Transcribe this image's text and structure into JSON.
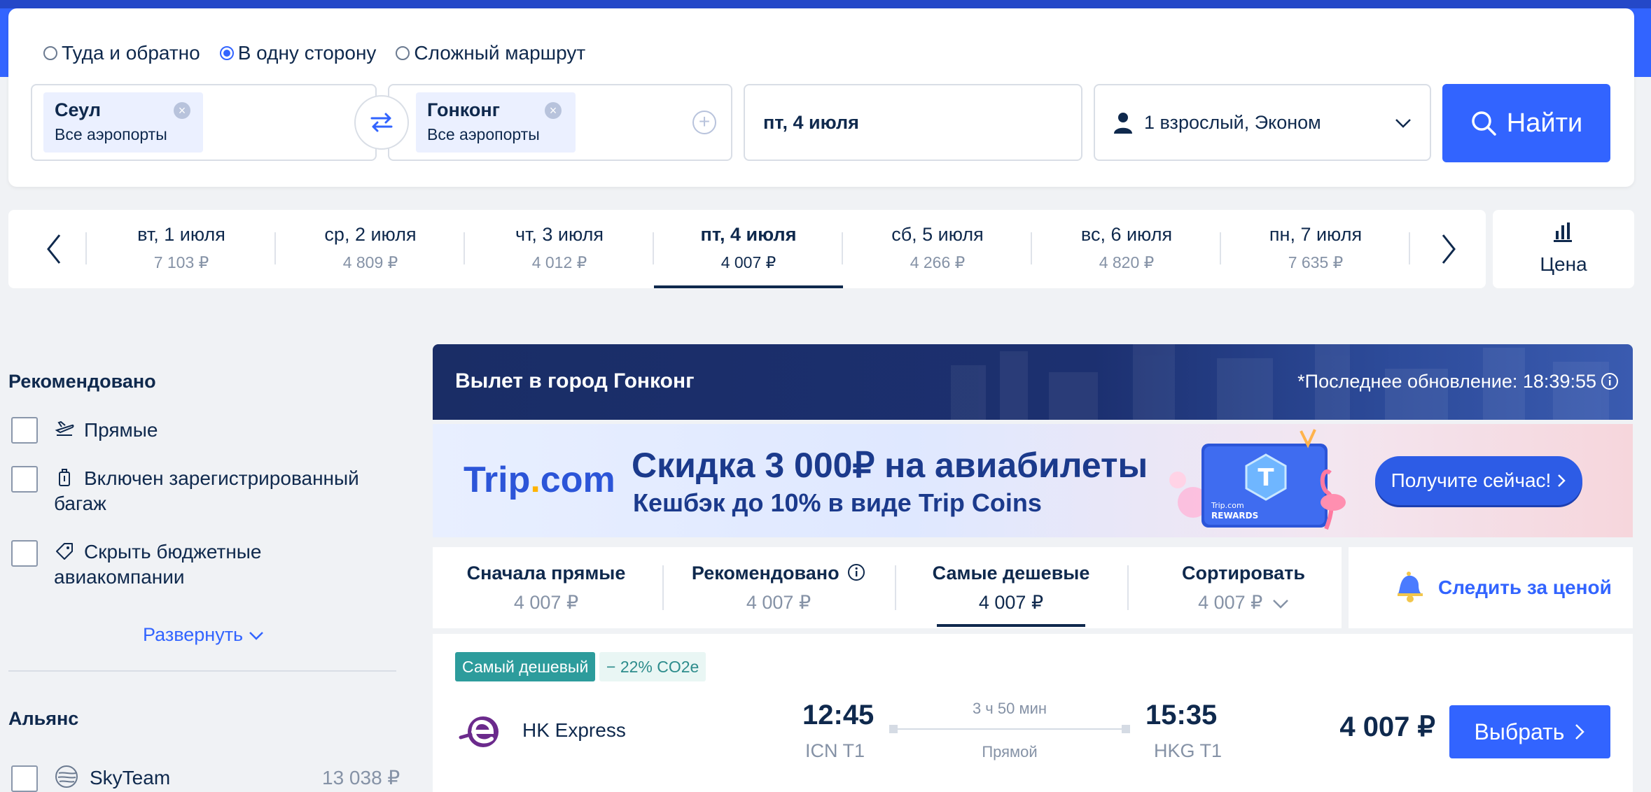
{
  "trip_types": [
    {
      "label": "Туда и обратно",
      "selected": false
    },
    {
      "label": "В одну сторону",
      "selected": true
    },
    {
      "label": "Сложный маршрут",
      "selected": false
    }
  ],
  "from": {
    "city": "Сеул",
    "airports": "Все аэропорты"
  },
  "to": {
    "city": "Гонконг",
    "airports": "Все аэропорты"
  },
  "date": "пт, 4 июля",
  "passengers": "1 взрослый, Эконом",
  "search_button": "Найти",
  "date_strip": [
    {
      "day": "вт, 1 июля",
      "price": "7 103 ₽"
    },
    {
      "day": "ср, 2 июля",
      "price": "4 809 ₽"
    },
    {
      "day": "чт, 3 июля",
      "price": "4 012 ₽"
    },
    {
      "day": "пт, 4 июля",
      "price": "4 007 ₽",
      "selected": true
    },
    {
      "day": "сб, 5 июля",
      "price": "4 266 ₽"
    },
    {
      "day": "вс, 6 июля",
      "price": "4 820 ₽"
    },
    {
      "day": "пн, 7 июля",
      "price": "7 635 ₽"
    }
  ],
  "price_toggle": "Цена",
  "sidebar": {
    "recommended_title": "Рекомендовано",
    "filters": [
      {
        "label": "Прямые"
      },
      {
        "label": "Включен зарегистрированный багаж"
      },
      {
        "label": "Скрыть бюджетные авиакомпании"
      }
    ],
    "expand": "Развернуть",
    "alliance_title": "Альянс",
    "alliance_item": {
      "label": "SkyTeam",
      "price": "13 038 ₽"
    }
  },
  "departure": {
    "title": "Вылет в город Гонконг",
    "update": "*Последнее обновление: 18:39:55"
  },
  "promo": {
    "logo_main": "Trip",
    "logo_dot": ".",
    "logo_end": "com",
    "headline": "Скидка 3 000₽ на авиабилеты",
    "sub": "Кешбэк до 10% в виде Trip Coins",
    "button": "Получите сейчас!",
    "card_brand": "Trip.com",
    "card_rewards": "REWARDS"
  },
  "sort_tabs": [
    {
      "title": "Сначала прямые",
      "price": "4 007 ₽"
    },
    {
      "title": "Рекомендовано",
      "price": "4 007 ₽"
    },
    {
      "title": "Самые дешевые",
      "price": "4 007 ₽",
      "selected": true
    },
    {
      "title": "Сортировать",
      "price": "4 007 ₽"
    }
  ],
  "watch_price": "Следить за ценой",
  "flight": {
    "badge_cheapest": "Самый дешевый",
    "badge_co2": "− 22% CO2e",
    "airline": "HK Express",
    "dep_time": "12:45",
    "dep_airport": "ICN T1",
    "duration": "3 ч 50 мин",
    "stops": "Прямой",
    "arr_time": "15:35",
    "arr_airport": "HKG T1",
    "price": "4 007 ₽",
    "select": "Выбрать"
  },
  "colors": {
    "accent": "#3264ff",
    "navy": "#0f294d",
    "teal": "#2d9c9c"
  }
}
